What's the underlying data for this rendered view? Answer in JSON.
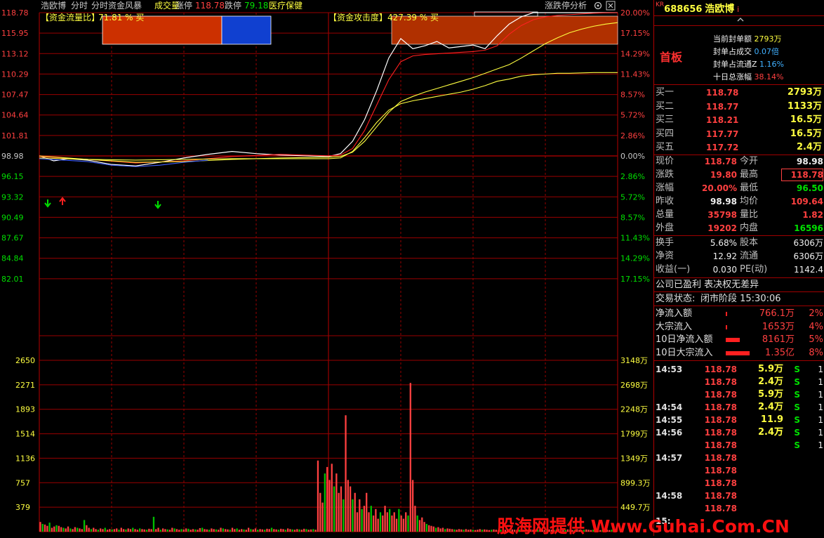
{
  "header": {
    "stock_name": "浩欧博",
    "mode1": "分时",
    "mode2": "分时资金风暴",
    "mode3": "成交量",
    "limit_up_label": "涨停",
    "limit_up_value": "118.78",
    "limit_down_label": "跌停",
    "limit_down_value": "79.18",
    "sector": "医疗保健",
    "top_right_link": "涨跌停分析",
    "settings_icon": "gear-icon",
    "close_icon": "close-icon"
  },
  "indicators": {
    "flow_ratio_label": "【资金流量比】",
    "flow_ratio_value": "71.81 % 买",
    "attack_label": "【资金攻击度】",
    "attack_value": "427.39 % 买"
  },
  "price_axis": {
    "left": [
      "118.78",
      "115.95",
      "113.12",
      "110.29",
      "107.47",
      "104.64",
      "101.81",
      "98.98",
      "96.15",
      "93.32",
      "90.49",
      "87.67",
      "84.84",
      "82.01"
    ],
    "right": [
      "20.00%",
      "17.15%",
      "14.29%",
      "11.43%",
      "8.57%",
      "5.72%",
      "2.86%",
      "0.00%",
      "2.86%",
      "5.72%",
      "8.57%",
      "11.43%",
      "14.29%",
      "17.15%"
    ]
  },
  "volume_axis": {
    "left": [
      "2650",
      "2271",
      "1893",
      "1514",
      "1136",
      "757",
      "379"
    ],
    "right": [
      "3148万",
      "2698万",
      "2248万",
      "1799万",
      "1349万",
      "899.3万",
      "449.7万"
    ]
  },
  "chart_data": {
    "type": "line",
    "title": "",
    "xlabel": "",
    "ylabel": "",
    "x_range": [
      0,
      240
    ],
    "ylim": [
      82.01,
      118.78
    ],
    "prev_close": 98.98,
    "series": [
      {
        "color": "#ffffff",
        "x": [
          0,
          6,
          12,
          20,
          30,
          40,
          50,
          60,
          70,
          80,
          90,
          100,
          110,
          120,
          125,
          130,
          135,
          140,
          145,
          150,
          155,
          160,
          165,
          170,
          175,
          180,
          185,
          190,
          195,
          200,
          205,
          210,
          215,
          220,
          225,
          230,
          235,
          240
        ],
        "values": [
          98.98,
          98.3,
          98.6,
          98.4,
          97.8,
          97.6,
          98.1,
          98.7,
          99.2,
          99.6,
          99.3,
          99.1,
          99.0,
          98.9,
          99.3,
          101.0,
          104.0,
          108.0,
          112.5,
          115.2,
          113.8,
          114.2,
          114.8,
          113.9,
          114.1,
          114.3,
          113.8,
          115.6,
          117.2,
          118.2,
          118.78,
          118.78,
          118.78,
          118.78,
          118.78,
          118.78,
          118.78,
          118.78
        ]
      },
      {
        "color": "#ff2020",
        "x": [
          0,
          20,
          40,
          60,
          80,
          100,
          120,
          125,
          130,
          135,
          140,
          145,
          150,
          155,
          160,
          165,
          170,
          175,
          180,
          185,
          190,
          195,
          200,
          205,
          210,
          215,
          220,
          225,
          230,
          235,
          240
        ],
        "values": [
          98.9,
          98.5,
          98.0,
          98.3,
          98.9,
          99.2,
          99.0,
          99.1,
          100.0,
          102.5,
          106.0,
          109.5,
          112.0,
          112.8,
          113.0,
          113.1,
          113.2,
          113.3,
          113.4,
          113.6,
          114.2,
          115.8,
          117.0,
          117.8,
          118.2,
          118.4,
          118.5,
          118.6,
          118.7,
          118.75,
          118.78
        ]
      },
      {
        "color": "#ffff40",
        "x": [
          0,
          20,
          40,
          60,
          80,
          100,
          120,
          125,
          130,
          135,
          140,
          145,
          150,
          155,
          160,
          165,
          170,
          175,
          180,
          185,
          190,
          195,
          200,
          205,
          210,
          215,
          220,
          225,
          230,
          235,
          240
        ],
        "values": [
          98.98,
          98.5,
          98.1,
          98.2,
          98.5,
          98.7,
          98.8,
          98.9,
          99.5,
          101.0,
          103.0,
          105.0,
          106.5,
          107.2,
          107.8,
          108.3,
          108.8,
          109.3,
          109.8,
          110.4,
          111.0,
          111.6,
          112.5,
          113.5,
          114.5,
          115.3,
          116.0,
          116.5,
          116.9,
          117.2,
          117.4
        ]
      },
      {
        "color": "#ffff40",
        "x": [
          0,
          20,
          40,
          60,
          80,
          100,
          120,
          125,
          130,
          135,
          140,
          145,
          150,
          155,
          160,
          165,
          170,
          175,
          180,
          185,
          190,
          195,
          200,
          205,
          210,
          215,
          220,
          225,
          230,
          235,
          240
        ],
        "values": [
          98.7,
          98.5,
          98.4,
          98.5,
          98.6,
          98.6,
          98.6,
          98.7,
          99.6,
          101.5,
          103.6,
          105.3,
          106.2,
          106.6,
          106.9,
          107.2,
          107.5,
          107.8,
          108.2,
          108.7,
          109.3,
          109.6,
          110.0,
          110.2,
          110.3,
          110.4,
          110.4,
          110.45,
          110.5,
          110.5,
          110.5
        ]
      },
      {
        "color": "#4060ff",
        "x": [
          0,
          10,
          20,
          30,
          40,
          50,
          60,
          70
        ],
        "values": [
          98.6,
          98.4,
          98.2,
          97.7,
          97.5,
          97.7,
          98.1,
          98.4
        ]
      }
    ],
    "volume": {
      "ylim": [
        0,
        2650
      ],
      "limit_up_time_x": 168,
      "values": [
        150,
        120,
        110,
        90,
        140,
        60,
        80,
        100,
        90,
        70,
        60,
        50,
        80,
        50,
        40,
        70,
        60,
        50,
        40,
        180,
        100,
        60,
        40,
        60,
        40,
        30,
        50,
        40,
        60,
        30,
        40,
        35,
        40,
        50,
        30,
        60,
        40,
        35,
        50,
        40,
        60,
        40,
        30,
        50,
        40,
        35,
        30,
        45,
        40,
        230,
        40,
        60,
        30,
        50,
        40,
        35,
        30,
        60,
        50,
        40,
        30,
        40,
        35,
        50,
        45,
        30,
        40,
        35,
        30,
        55,
        60,
        40,
        35,
        30,
        50,
        40,
        35,
        30,
        60,
        50,
        40,
        35,
        30,
        60,
        40,
        50,
        30,
        40,
        35,
        30,
        60,
        40,
        35,
        50,
        30,
        40,
        35,
        30,
        45,
        40,
        60,
        40,
        35,
        30,
        45,
        40,
        30,
        50,
        40,
        35,
        30,
        40,
        35,
        30,
        45,
        40,
        30,
        35,
        40,
        30,
        1100,
        600,
        450,
        900,
        1000,
        800,
        1050,
        700,
        900,
        600,
        700,
        500,
        1800,
        800,
        700,
        500,
        600,
        300,
        500,
        350,
        400,
        600,
        300,
        400,
        250,
        350,
        200,
        300,
        250,
        400,
        300,
        350,
        250,
        300,
        200,
        350,
        250,
        200,
        300,
        250,
        2300,
        800,
        400,
        250,
        180,
        220,
        150,
        120,
        100,
        90,
        80,
        60,
        70,
        50,
        60,
        40,
        50,
        45,
        40,
        35,
        30,
        40,
        35,
        30,
        40,
        30,
        35,
        30,
        25,
        30,
        40,
        30,
        35,
        30,
        25,
        30,
        35,
        30,
        25,
        30,
        40,
        30,
        25,
        30,
        35,
        30,
        25,
        30,
        40,
        30,
        25,
        30,
        35,
        30,
        25,
        30,
        40,
        30,
        25,
        30,
        35,
        30,
        25,
        30,
        40,
        30,
        25,
        30,
        35,
        30,
        25,
        30,
        40,
        30,
        25,
        30,
        35,
        30,
        25,
        30,
        40,
        30,
        25,
        30,
        35,
        30,
        25,
        30,
        40,
        30
      ],
      "colors_note": ""
    }
  },
  "panel": {
    "code_prefix": "KR",
    "code": "688656",
    "name": "浩欧博",
    "info_mark": "i",
    "up_arrow": "chevron-up-icon",
    "board_label": "首板",
    "seal_amount_label": "当前封单额",
    "seal_amount_value": "2793万",
    "seal_vol_label": "封单占成交",
    "seal_vol_value": "0.07倍",
    "seal_float_label": "封单占流通Z",
    "seal_float_value": "1.16%",
    "ten_day_label": "十日总涨幅",
    "ten_day_value": "38.14%",
    "bids": [
      {
        "label": "买一",
        "price": "118.78",
        "vol": "2793万"
      },
      {
        "label": "买二",
        "price": "118.77",
        "vol": "1133万"
      },
      {
        "label": "买三",
        "price": "118.21",
        "vol": "16.5万"
      },
      {
        "label": "买四",
        "price": "117.77",
        "vol": "16.5万"
      },
      {
        "label": "买五",
        "price": "117.72",
        "vol": "2.4万"
      }
    ],
    "quote": [
      {
        "l1": "现价",
        "v1": "118.78",
        "c1": "red",
        "l2": "今开",
        "v2": "98.98",
        "c2": "white"
      },
      {
        "l1": "涨跌",
        "v1": "19.80",
        "c1": "red",
        "l2": "最高",
        "v2": "118.78",
        "c2": "red"
      },
      {
        "l1": "涨幅",
        "v1": "20.00%",
        "c1": "red",
        "l2": "最低",
        "v2": "96.50",
        "c2": "green"
      },
      {
        "l1": "昨收",
        "v1": "98.98",
        "c1": "white",
        "l2": "均价",
        "v2": "109.64",
        "c2": "red"
      },
      {
        "l1": "总量",
        "v1": "35798",
        "c1": "red",
        "l2": "量比",
        "v2": "1.82",
        "c2": "red"
      },
      {
        "l1": "外盘",
        "v1": "19202",
        "c1": "red",
        "l2": "内盘",
        "v2": "16596",
        "c2": "green"
      }
    ],
    "stats": [
      {
        "l1": "换手",
        "v1": "5.68%",
        "l2": "股本",
        "v2": "6306万"
      },
      {
        "l1": "净资",
        "v1": "12.92",
        "l2": "流通",
        "v2": "6306万"
      },
      {
        "l1": "收益(一)",
        "v1": "0.030",
        "l2": "PE(动)",
        "v2": "1142.4"
      }
    ],
    "company_note": "公司已盈利 表决权无差异",
    "trade_status_label": "交易状态:",
    "trade_status_value": "闭市阶段 15:30:06",
    "flows": [
      {
        "label": "净流入额",
        "value": "766.1万",
        "pct": "2%",
        "bar": 0.03
      },
      {
        "label": "大宗流入",
        "value": "1653万",
        "pct": "4%",
        "bar": 0.06
      },
      {
        "label": "10日净流入额",
        "value": "8161万",
        "pct": "5%",
        "bar": 0.6
      },
      {
        "label": "10日大宗流入",
        "value": "1.35亿",
        "pct": "8%",
        "bar": 1.0
      }
    ],
    "ticks": [
      {
        "time": "14:53",
        "price": "118.78",
        "vol": "5.9万",
        "side": "S",
        "n": "1"
      },
      {
        "time": "",
        "price": "118.78",
        "vol": "2.4万",
        "side": "S",
        "n": "1"
      },
      {
        "time": "",
        "price": "118.78",
        "vol": "5.9万",
        "side": "S",
        "n": "1"
      },
      {
        "time": "14:54",
        "price": "118.78",
        "vol": "2.4万",
        "side": "S",
        "n": "1"
      },
      {
        "time": "14:55",
        "price": "118.78",
        "vol": "11.9万",
        "side": "S",
        "n": "1"
      },
      {
        "time": "14:56",
        "price": "118.78",
        "vol": "2.4万",
        "side": "S",
        "n": "1"
      },
      {
        "time": "",
        "price": "118.78",
        "vol": "",
        "side": "S",
        "n": "1"
      },
      {
        "time": "14:57",
        "price": "118.78",
        "vol": "",
        "side": "",
        "n": ""
      },
      {
        "time": "",
        "price": "118.78",
        "vol": "",
        "side": "",
        "n": ""
      },
      {
        "time": "",
        "price": "118.78",
        "vol": "",
        "side": "",
        "n": ""
      },
      {
        "time": "14:58",
        "price": "118.78",
        "vol": "",
        "side": "",
        "n": ""
      },
      {
        "time": "",
        "price": "118.78",
        "vol": "",
        "side": "",
        "n": ""
      },
      {
        "time": "15:",
        "price": "",
        "vol": "",
        "side": "",
        "n": ""
      }
    ]
  },
  "watermark": "股海网提供 Www.Guhai.Com.CN"
}
